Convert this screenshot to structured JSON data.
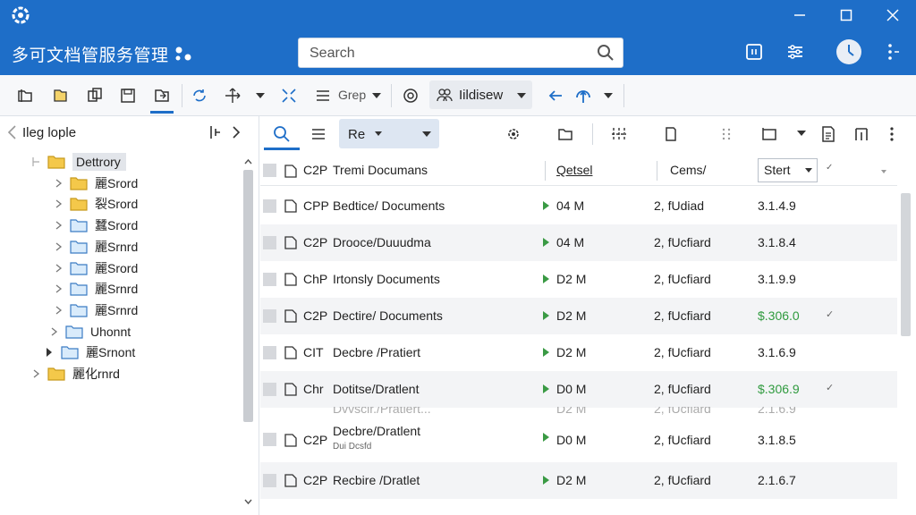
{
  "titlebar": {
    "title": "多可文档管服务管理",
    "search_placeholder": "Search",
    "accent_color": "#1e6ec8"
  },
  "toolbar": {
    "grep_label": "Grep",
    "view_label": "Iildisew"
  },
  "tree": {
    "header": "Ileg lople",
    "items": [
      {
        "label": "Dettrory",
        "level": 0,
        "selected": true
      },
      {
        "label": "麗Srord",
        "level": 1
      },
      {
        "label": "裂Srord",
        "level": 1
      },
      {
        "label": "蠶Srord",
        "level": 1
      },
      {
        "label": "麗Srnrd",
        "level": 1
      },
      {
        "label": "麗Srord",
        "level": 1
      },
      {
        "label": "麗Srnrd",
        "level": 1
      },
      {
        "label": "麗Srnrd",
        "level": 1
      },
      {
        "label": "Uhonnt",
        "level": 1
      },
      {
        "label": "麗Srnont",
        "level": 1
      },
      {
        "label": "麗化rnrd",
        "level": 0
      }
    ]
  },
  "list": {
    "filter_label": "Re",
    "columns": {
      "prefix": "C2P",
      "name": "Tremi Documans",
      "size": "Qetsel",
      "owner": "Cems/",
      "version": "Stert"
    },
    "rows": [
      {
        "prefix": "CPP",
        "name": "Bedtice/ Documents",
        "size": "04 M",
        "owner": "2, fUdiad",
        "version": "3.1.4.9",
        "green": false,
        "tick": false
      },
      {
        "prefix": "C2P",
        "name": "Drooce/Duuudma",
        "size": "04 M",
        "owner": "2, fUcfiard",
        "version": "3.1.8.4",
        "green": false,
        "tick": false
      },
      {
        "prefix": "ChP",
        "name": "Irtonsly Documents",
        "size": "D2 M",
        "owner": "2, fUcfiard",
        "version": "3.1.9.9",
        "green": false,
        "tick": false
      },
      {
        "prefix": "C2P",
        "name": "Dectire/ Documents",
        "size": "D2 M",
        "owner": "2, fUcfiard",
        "version": "$.306.0",
        "green": true,
        "tick": true
      },
      {
        "prefix": "CIT",
        "name": "Decbre /Pratiert",
        "size": "D2 M",
        "owner": "2, fUcfiard",
        "version": "3.1.6.9",
        "green": false,
        "tick": false
      },
      {
        "prefix": "Chr",
        "name": "Dotitse/Dratlent",
        "size": "D0 M",
        "owner": "2, fUcfiard",
        "version": "$.306.9",
        "green": true,
        "tick": true
      },
      {
        "prefix": "C2P",
        "name": "Decbre/Dratlent",
        "sub": "Dui Dcsfd",
        "size": "D0 M",
        "owner": "2, fUcfiard",
        "version": "3.1.8.5",
        "green": false,
        "tick": false
      },
      {
        "prefix": "C2P",
        "name": "Recbire /Dratlet",
        "size": "D2 M",
        "owner": "2, fUcfiard",
        "version": "2.1.6.7",
        "green": false,
        "tick": false
      }
    ],
    "ghost": {
      "name": "Dvvsclr./Pratiert...",
      "size": "D2 M",
      "owner": "2, fUcfiard",
      "version": "2.1.6.9"
    },
    "tick_char": "✓"
  },
  "icons": {
    "app_logo": "gear-cog-icon",
    "share": "share-icon",
    "search": "search-icon",
    "avatar": "avatar-clock-icon"
  }
}
